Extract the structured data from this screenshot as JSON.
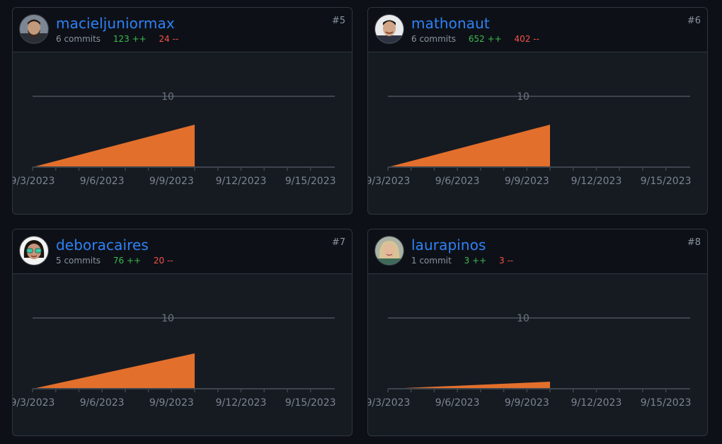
{
  "cards": [
    {
      "username": "macieljuniormax",
      "rank": "#5",
      "commits": "6 commits",
      "additions": "123 ++",
      "deletions": "24 --",
      "avatar": "bearded-man-avatar",
      "chart_data": {
        "type": "area",
        "x": [
          "9/3/2023",
          "9/10/2023"
        ],
        "y": [
          0,
          6
        ],
        "ylim": [
          0,
          10
        ],
        "yticks": [
          "10"
        ],
        "xticks": [
          "9/3/2023",
          "9/6/2023",
          "9/9/2023",
          "9/12/2023",
          "9/15/2023"
        ],
        "color": "#e36f2c"
      }
    },
    {
      "username": "mathonaut",
      "rank": "#6",
      "commits": "6 commits",
      "additions": "652 ++",
      "deletions": "402 --",
      "avatar": "smiling-man-avatar",
      "chart_data": {
        "type": "area",
        "x": [
          "9/3/2023",
          "9/10/2023"
        ],
        "y": [
          0,
          6
        ],
        "ylim": [
          0,
          10
        ],
        "yticks": [
          "10"
        ],
        "xticks": [
          "9/3/2023",
          "9/6/2023",
          "9/9/2023",
          "9/12/2023",
          "9/15/2023"
        ],
        "color": "#e36f2c"
      }
    },
    {
      "username": "deboracaires",
      "rank": "#7",
      "commits": "5 commits",
      "additions": "76 ++",
      "deletions": "20 --",
      "avatar": "woman-glasses-avatar",
      "chart_data": {
        "type": "area",
        "x": [
          "9/3/2023",
          "9/10/2023"
        ],
        "y": [
          0,
          5
        ],
        "ylim": [
          0,
          10
        ],
        "yticks": [
          "10"
        ],
        "xticks": [
          "9/3/2023",
          "9/6/2023",
          "9/9/2023",
          "9/12/2023",
          "9/15/2023"
        ],
        "color": "#e36f2c"
      }
    },
    {
      "username": "laurapinos",
      "rank": "#8",
      "commits": "1 commit",
      "additions": "3 ++",
      "deletions": "3 --",
      "avatar": "blonde-woman-avatar",
      "chart_data": {
        "type": "area",
        "x": [
          "9/3/2023",
          "9/10/2023"
        ],
        "y": [
          0,
          1
        ],
        "ylim": [
          0,
          10
        ],
        "yticks": [
          "10"
        ],
        "xticks": [
          "9/3/2023",
          "9/6/2023",
          "9/9/2023",
          "9/12/2023",
          "9/15/2023"
        ],
        "color": "#e36f2c"
      }
    }
  ]
}
